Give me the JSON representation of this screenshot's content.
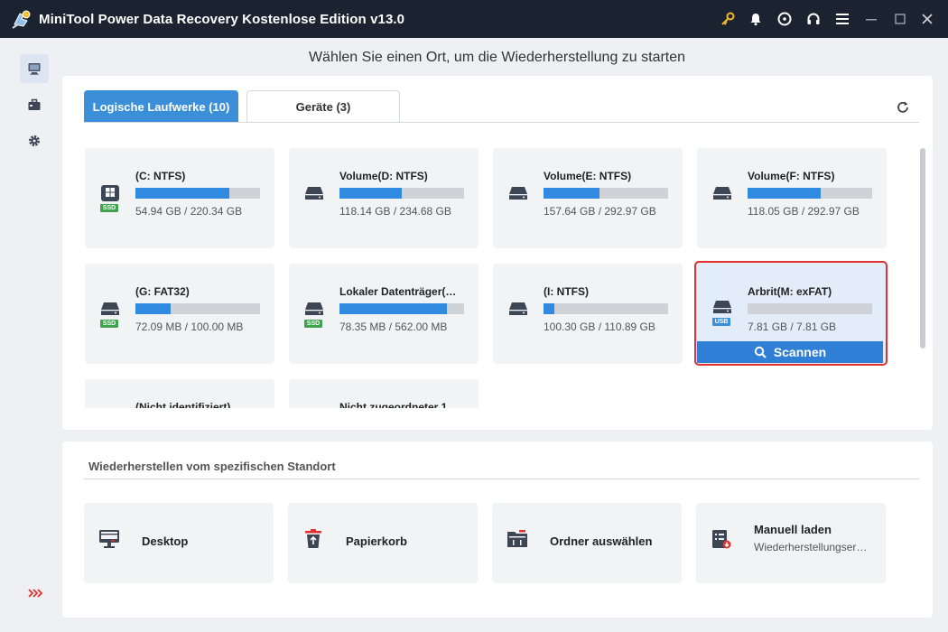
{
  "window": {
    "title": "MiniTool Power Data Recovery Kostenlose Edition v13.0",
    "titlebar_icons": [
      "key-icon",
      "bell-icon",
      "disc-icon",
      "headphones-icon",
      "menu-icon",
      "minimize-icon",
      "maximize-icon",
      "close-icon"
    ],
    "accent_color": "#3a8fd8",
    "titlebar_color": "#1b2330"
  },
  "sidebar": {
    "items": [
      {
        "name": "this-pc-icon",
        "active": true
      },
      {
        "name": "toolbox-icon",
        "active": false
      },
      {
        "name": "settings-icon",
        "active": false
      }
    ]
  },
  "main": {
    "heading": "Wählen Sie einen Ort, um die Wiederherstellung zu starten",
    "tabs": [
      {
        "label": "Logische Laufwerke (10)",
        "active": true
      },
      {
        "label": "Geräte (3)",
        "active": false
      }
    ],
    "drives": [
      {
        "name": "(C: NTFS)",
        "size": "54.94 GB / 220.34 GB",
        "used": 0.75,
        "badge": "SSD",
        "icon": "windows-drive-icon"
      },
      {
        "name": "Volume(D: NTFS)",
        "size": "118.14 GB / 234.68 GB",
        "used": 0.5,
        "badge": "",
        "icon": "drive-icon"
      },
      {
        "name": "Volume(E: NTFS)",
        "size": "157.64 GB / 292.97 GB",
        "used": 0.45,
        "badge": "",
        "icon": "drive-icon"
      },
      {
        "name": "Volume(F: NTFS)",
        "size": "118.05 GB / 292.97 GB",
        "used": 0.59,
        "badge": "",
        "icon": "drive-icon"
      },
      {
        "name": "(G: FAT32)",
        "size": "72.09 MB / 100.00 MB",
        "used": 0.28,
        "badge": "SSD",
        "icon": "drive-icon"
      },
      {
        "name": "Lokaler Datenträger(…",
        "size": "78.35 MB / 562.00 MB",
        "used": 0.86,
        "badge": "SSD",
        "icon": "drive-icon"
      },
      {
        "name": "(I: NTFS)",
        "size": "100.30 GB / 110.89 GB",
        "used": 0.09,
        "badge": "",
        "icon": "drive-icon"
      },
      {
        "name": "Arbrit(M: exFAT)",
        "size": "7.81 GB / 7.81 GB",
        "used": 0.0,
        "badge": "USB",
        "icon": "drive-icon",
        "selected": true
      },
      {
        "name": "(Nicht identifiziert)",
        "size": "",
        "used": 0,
        "badge": "",
        "icon": ""
      },
      {
        "name": "Nicht zugeordneter 1",
        "size": "",
        "used": 0,
        "badge": "",
        "icon": ""
      }
    ],
    "scan_label": "Scannen"
  },
  "locations": {
    "title": "Wiederherstellen vom spezifischen Standort",
    "items": [
      {
        "label": "Desktop",
        "sub": "",
        "icon": "desktop-icon"
      },
      {
        "label": "Papierkorb",
        "sub": "",
        "icon": "recycle-bin-icon"
      },
      {
        "label": "Ordner auswählen",
        "sub": "",
        "icon": "folder-icon"
      },
      {
        "label": "Manuell laden",
        "sub": "Wiederherstellungser…",
        "icon": "load-file-icon"
      }
    ]
  }
}
